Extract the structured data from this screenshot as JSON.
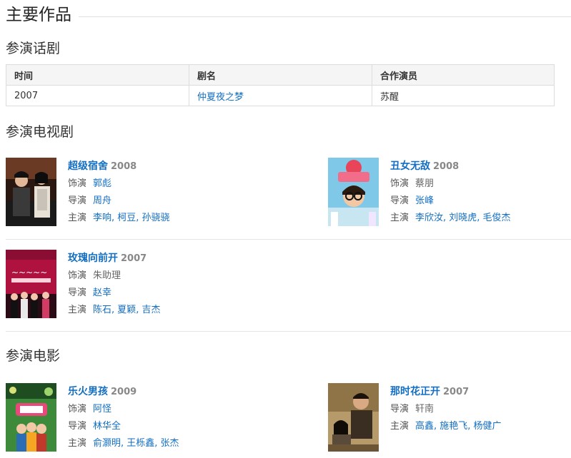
{
  "main_title": "主要作品",
  "drama": {
    "title": "参演话剧",
    "headers": [
      "时间",
      "剧名",
      "合作演员"
    ],
    "rows": [
      [
        "2007",
        "仲夏夜之梦",
        "苏醒"
      ]
    ]
  },
  "tv": {
    "title": "参演电视剧",
    "items": [
      {
        "title": "超级宿舍",
        "year": "2008",
        "role_label": "饰演",
        "role": "郭彪",
        "director_label": "导演",
        "director": "周舟",
        "cast_label": "主演",
        "cast": "李响, 柯豆, 孙骁骁"
      },
      {
        "title": "丑女无敌",
        "year": "2008",
        "role_label": "饰演",
        "role": "蔡朋",
        "director_label": "导演",
        "director": "张峰",
        "cast_label": "主演",
        "cast": "李欣汝, 刘晓虎, 毛俊杰"
      },
      {
        "title": "玫瑰向前开",
        "year": "2007",
        "role_label": "饰演",
        "role": "朱助理",
        "director_label": "导演",
        "director": "赵幸",
        "cast_label": "主演",
        "cast": "陈石, 夏颖, 吉杰"
      }
    ]
  },
  "film": {
    "title": "参演电影",
    "items": [
      {
        "title": "乐火男孩",
        "year": "2009",
        "role_label": "饰演",
        "role": "阿怪",
        "director_label": "导演",
        "director": "林华全",
        "cast_label": "主演",
        "cast": "俞灏明, 王栎鑫, 张杰"
      },
      {
        "title": "那时花正开",
        "year": "2007",
        "director_label": "导演",
        "director": "轩南",
        "cast_label": "主演",
        "cast": "高鑫, 施艳飞, 杨健广"
      }
    ]
  }
}
